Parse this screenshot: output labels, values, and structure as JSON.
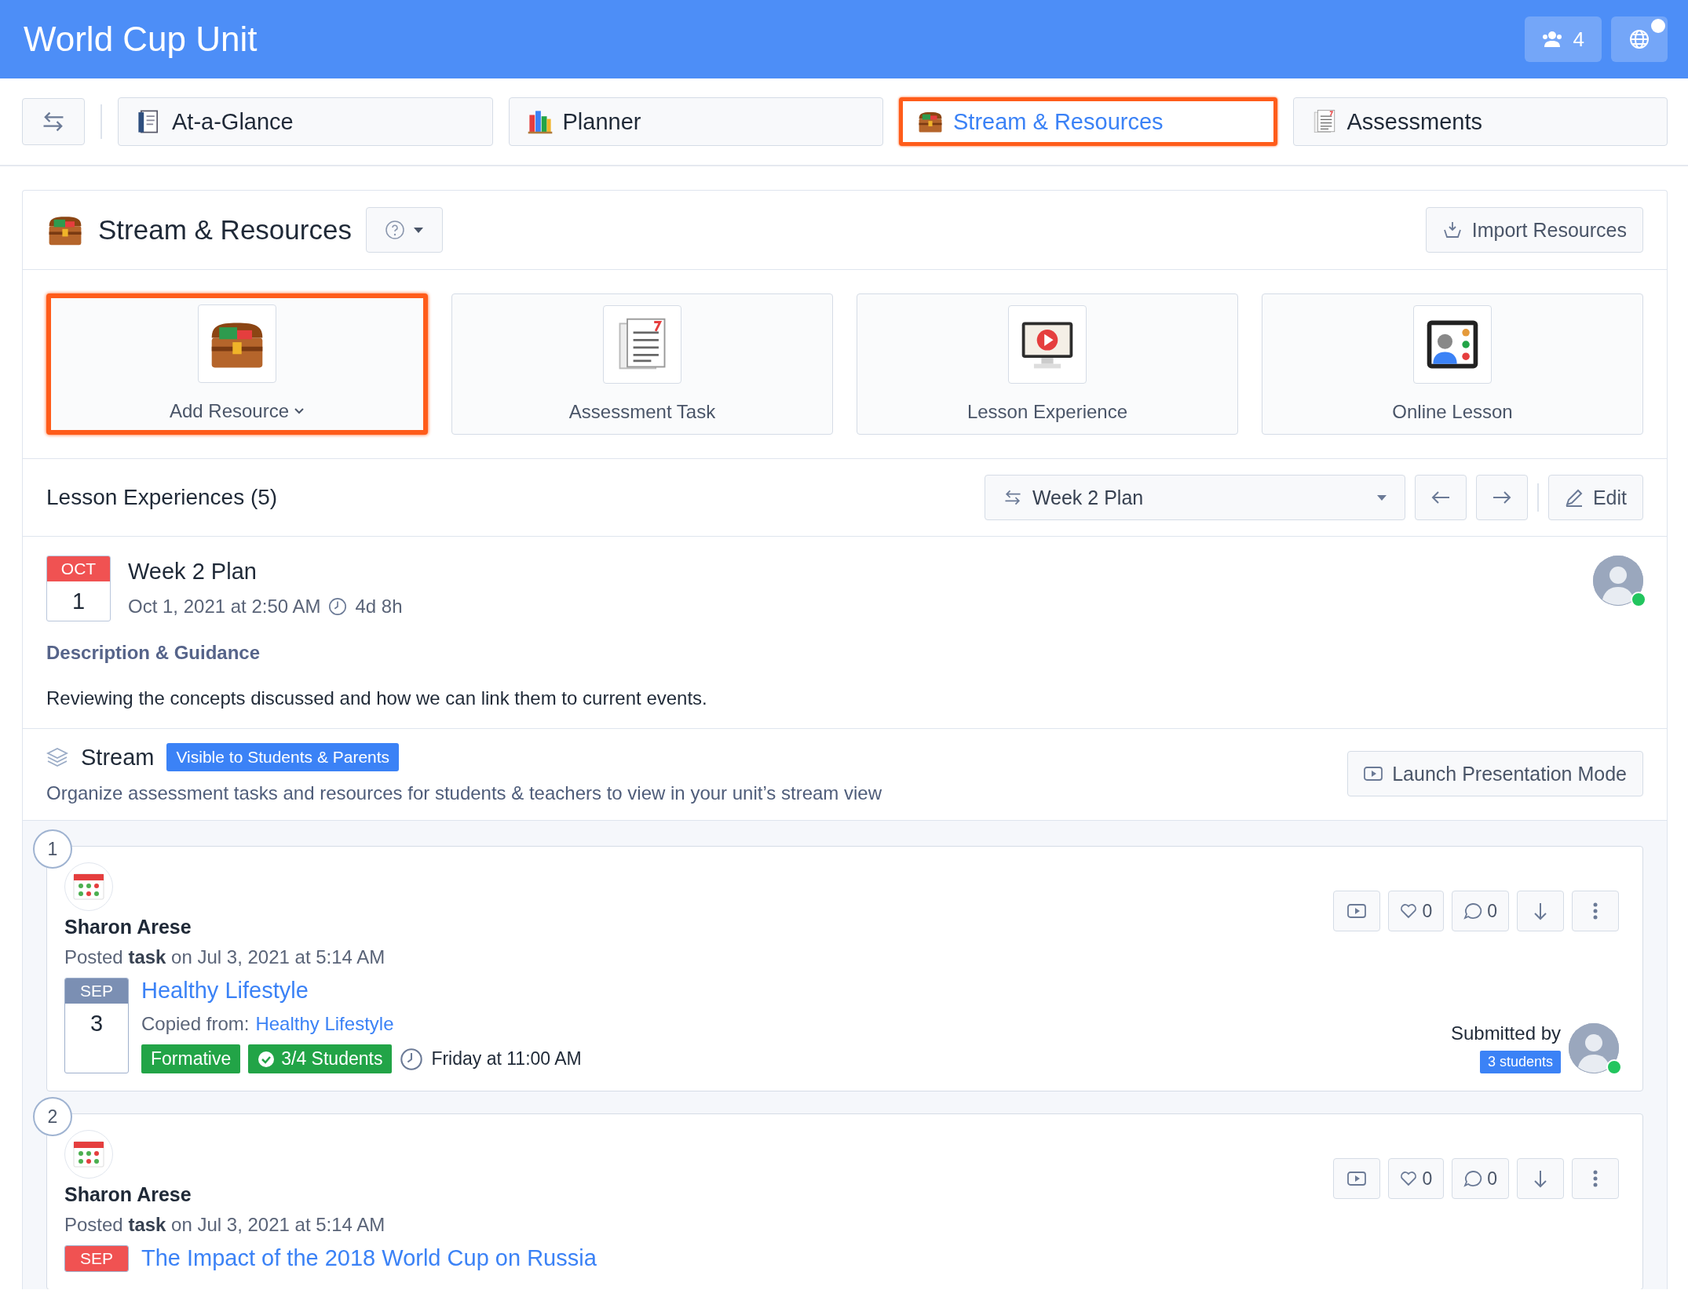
{
  "header": {
    "title": "World Cup Unit",
    "members_count": "4"
  },
  "nav": {
    "tabs": [
      {
        "label": "At-a-Glance",
        "kind": "glance",
        "selected": false
      },
      {
        "label": "Planner",
        "kind": "planner",
        "selected": false
      },
      {
        "label": "Stream & Resources",
        "kind": "chest",
        "selected": true
      },
      {
        "label": "Assessments",
        "kind": "document",
        "selected": false
      }
    ]
  },
  "panel": {
    "title": "Stream & Resources",
    "import_button": "Import Resources"
  },
  "resources": [
    {
      "label": "Add Resource",
      "kind": "chest",
      "has_menu": true,
      "selected": true
    },
    {
      "label": "Assessment Task",
      "kind": "document",
      "has_menu": false,
      "selected": false
    },
    {
      "label": "Lesson Experience",
      "kind": "video",
      "has_menu": false,
      "selected": false
    },
    {
      "label": "Online Lesson",
      "kind": "online",
      "has_menu": false,
      "selected": false
    }
  ],
  "lessons": {
    "title": "Lesson Experiences (5)",
    "plan_select": "Week 2 Plan",
    "edit_button": "Edit"
  },
  "lesson": {
    "month": "OCT",
    "day": "1",
    "title": "Week 2 Plan",
    "datetime": "Oct 1, 2021 at 2:50 AM",
    "duration": "4d 8h",
    "online": true,
    "description_heading": "Description & Guidance",
    "description": "Reviewing the concepts discussed and how we can link them to current events."
  },
  "stream": {
    "title": "Stream",
    "badge": "Visible to Students & Parents",
    "subtitle": "Organize assessment tasks and resources for students & teachers to view in your unit’s stream view",
    "launch_button": "Launch Presentation Mode"
  },
  "items": [
    {
      "number": "1",
      "author": "Sharon Arese",
      "posted": "Posted **task** on Jul 3, 2021 at 5:14 AM",
      "likes": "0",
      "comments": "0",
      "date": {
        "month": "SEP",
        "day": "3",
        "color": "#7b8fb3"
      },
      "title": "Healthy Lifestyle",
      "copied_label": "Copied from:",
      "copied_link": "Healthy Lifestyle",
      "tags": [
        {
          "label": "Formative",
          "kind": "plain"
        },
        {
          "label": "3/4 Students",
          "kind": "check"
        }
      ],
      "due": "Friday at 11:00 AM",
      "submitted_label": "Submitted by",
      "submitted_count": "3 students",
      "submitter_online": true
    },
    {
      "number": "2",
      "author": "Sharon Arese",
      "posted": "Posted **task** on Jul 3, 2021 at 5:14 AM",
      "likes": "0",
      "comments": "0",
      "date": {
        "month": "SEP",
        "color": "#f05252"
      },
      "title": "The Impact of the 2018 World Cup on Russia"
    }
  ]
}
